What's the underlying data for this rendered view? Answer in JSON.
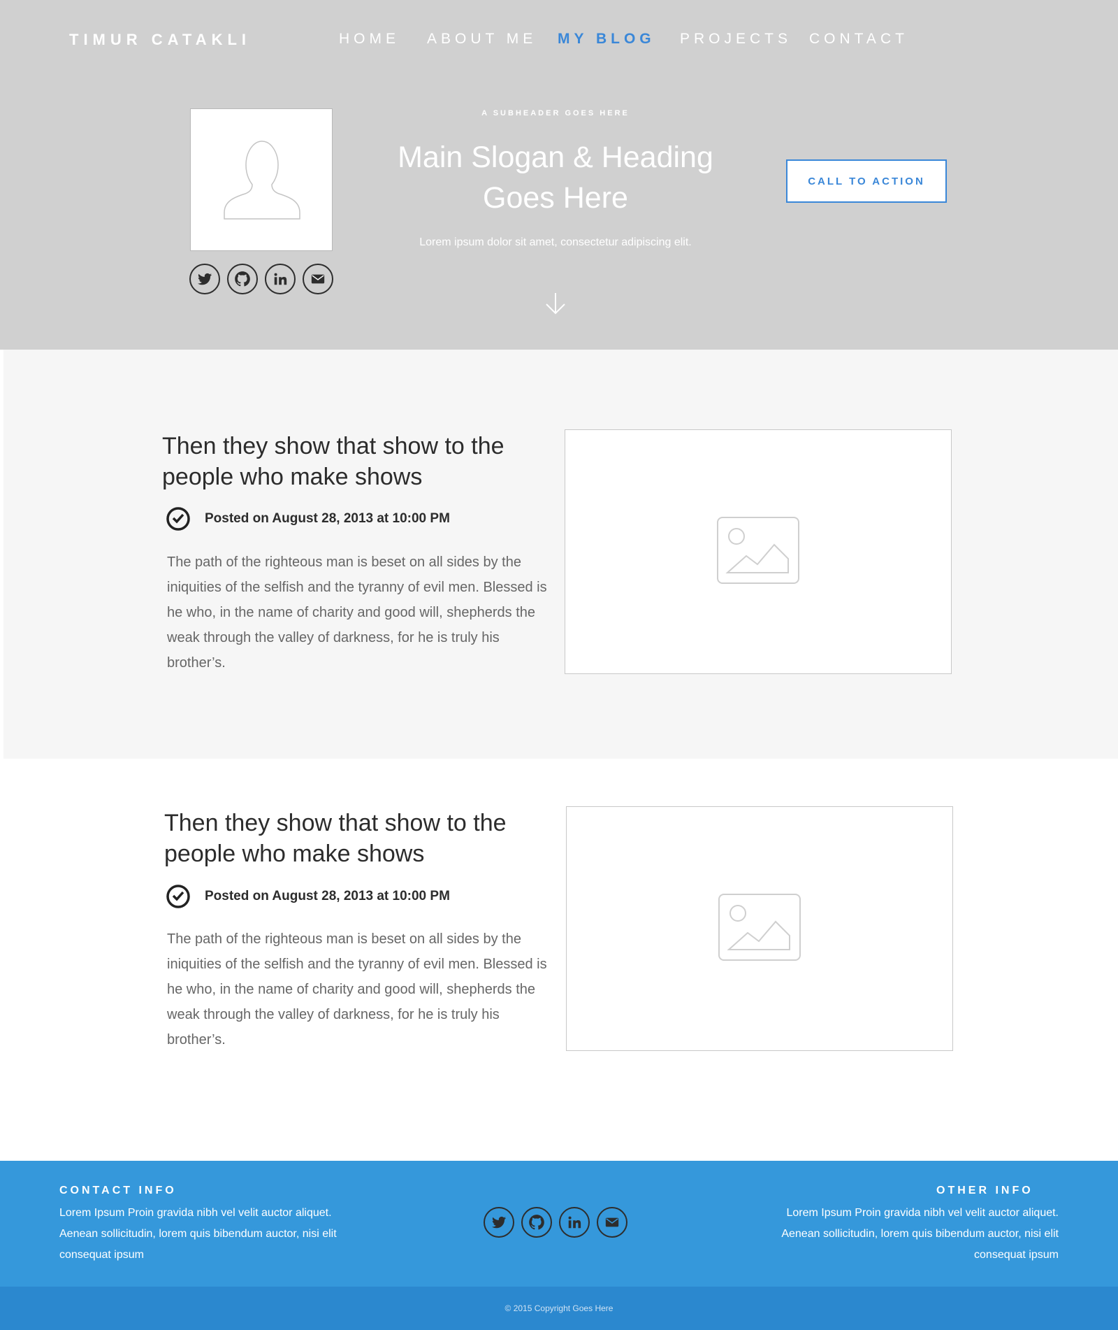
{
  "brand": {
    "name": "TIMUR CATAKLI"
  },
  "nav": {
    "items": [
      {
        "label": "HOME",
        "active": false
      },
      {
        "label": "ABOUT ME",
        "active": false
      },
      {
        "label": "MY BLOG",
        "active": true
      },
      {
        "label": "PROJECTS",
        "active": false
      },
      {
        "label": "CONTACT",
        "active": false
      }
    ]
  },
  "hero": {
    "subheader": "A SUBHEADER GOES HERE",
    "title": "Main Slogan & Heading Goes Here",
    "tagline": "Lorem ipsum dolor sit amet, consectetur adipiscing elit.",
    "cta_label": "CALL TO ACTION",
    "social_icons": [
      "twitter-icon",
      "github-icon",
      "linkedin-icon",
      "email-icon"
    ],
    "scroll_icon": "arrow-down-icon"
  },
  "posts": [
    {
      "title": "Then they show that show to the people who make shows",
      "date": "Posted on August 28, 2013 at 10:00 PM",
      "body": "The path of the righteous man is beset on all sides by the iniquities of the selfish and the tyranny of evil men. Blessed is he who, in the name of charity and good will, shepherds the weak through the valley of darkness, for he is truly his brother’s.",
      "image_icon": "image-placeholder-icon"
    },
    {
      "title": "Then they show that show to the people who make shows",
      "date": "Posted on August 28, 2013 at 10:00 PM",
      "body": "The path of the righteous man is beset on all sides by the iniquities of the selfish and the tyranny of evil men. Blessed is he who, in the name of charity and good will, shepherds the weak through the valley of darkness, for he is truly his brother’s.",
      "image_icon": "image-placeholder-icon"
    }
  ],
  "footer": {
    "contact_heading": "CONTACT INFO",
    "contact_text": "Lorem Ipsum Proin gravida nibh vel  velit auctor aliquet. Aenean sollicitudin, lorem quis bibendum auctor, nisi elit consequat ipsum",
    "other_heading": "OTHER INFO",
    "other_text": "Lorem Ipsum Proin gravida nibh vel  velit auctor aliquet. Aenean sollicitudin, lorem quis bibendum auctor, nisi elit consequat ipsum",
    "social_icons": [
      "twitter-icon",
      "github-icon",
      "linkedin-icon",
      "email-icon"
    ],
    "copyright": "© 2015 Copyright Goes Here"
  },
  "colors": {
    "hero_bg": "#d0d0d0",
    "accent": "#3a87d8",
    "footer_bg": "#3598db",
    "footer_bottom_bg": "#2b88cf",
    "post_section_bg": "#f6f6f6"
  }
}
